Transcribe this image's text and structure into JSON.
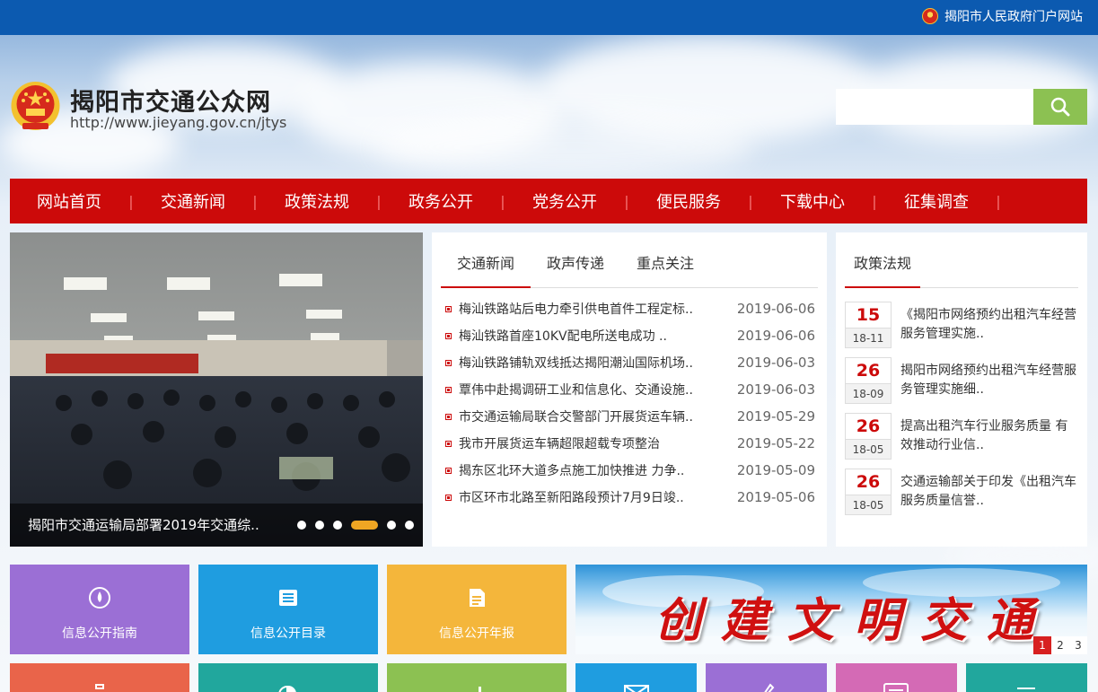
{
  "topbar": {
    "portal_link": "揭阳市人民政府门户网站"
  },
  "header": {
    "title": "揭阳市交通公众网",
    "url": "http://www.jieyang.gov.cn/jtys"
  },
  "search": {
    "placeholder": ""
  },
  "nav": [
    "网站首页",
    "交通新闻",
    "政策法规",
    "政务公开",
    "党务公开",
    "便民服务",
    "下载中心",
    "征集调查"
  ],
  "nav_separator": "|",
  "slider": {
    "caption": "揭阳市交通运输局部署2019年交通综..",
    "slide_count": 6,
    "active_index": 3
  },
  "news": {
    "tabs": [
      "交通新闻",
      "政声传递",
      "重点关注"
    ],
    "active_tab": 0,
    "items": [
      {
        "title": "梅汕铁路站后电力牵引供电首件工程定标..",
        "date": "2019-06-06"
      },
      {
        "title": "梅汕铁路首座10KV配电所送电成功 ..",
        "date": "2019-06-06"
      },
      {
        "title": "梅汕铁路铺轨双线抵达揭阳潮汕国际机场..",
        "date": "2019-06-03"
      },
      {
        "title": "覃伟中赴揭调研工业和信息化、交通设施..",
        "date": "2019-06-03"
      },
      {
        "title": "市交通运输局联合交警部门开展货运车辆..",
        "date": "2019-05-29"
      },
      {
        "title": "我市开展货运车辆超限超载专项整治",
        "date": "2019-05-22"
      },
      {
        "title": "揭东区北环大道多点施工加快推进 力争..",
        "date": "2019-05-09"
      },
      {
        "title": "市区环市北路至新阳路段预计7月9日竣..",
        "date": "2019-05-06"
      }
    ]
  },
  "policy": {
    "title": "政策法规",
    "items": [
      {
        "day": "15",
        "ym": "18-11",
        "text": "《揭阳市网络预约出租汽车经营服务管理实施.."
      },
      {
        "day": "26",
        "ym": "18-09",
        "text": "揭阳市网络预约出租汽车经营服务管理实施细.."
      },
      {
        "day": "26",
        "ym": "18-05",
        "text": "提高出租汽车行业服务质量 有效推动行业信.."
      },
      {
        "day": "26",
        "ym": "18-05",
        "text": "交通运输部关于印发《出租汽车服务质量信誉.."
      }
    ]
  },
  "tiles": [
    {
      "label": "信息公开指南",
      "color": "#9b6fd5",
      "icon": "compass-icon"
    },
    {
      "label": "信息公开目录",
      "color": "#1f9de0",
      "icon": "catalog-icon"
    },
    {
      "label": "信息公开年报",
      "color": "#f4b63b",
      "icon": "report-icon"
    }
  ],
  "small_tiles": [
    {
      "color": "#e9644a",
      "icon": "briefcase-icon"
    },
    {
      "color": "#21a79d",
      "icon": "pie-chart-icon"
    },
    {
      "color": "#8cc152",
      "icon": "chart-icon"
    },
    {
      "color": "#1f9de0",
      "icon": "mail-icon"
    },
    {
      "color": "#9b6fd5",
      "icon": "pen-icon"
    },
    {
      "color": "#d46ab5",
      "icon": "document-icon"
    },
    {
      "color": "#21a79d",
      "icon": "list-icon"
    }
  ],
  "banner": {
    "text": "创建文明交通",
    "pages": [
      "1",
      "2",
      "3"
    ],
    "active_page": 0
  },
  "colors": {
    "nav_red": "#cc0a0a",
    "topbar_blue": "#0c5ab0",
    "search_green": "#8cc152",
    "dot_orange": "#f0a623"
  }
}
